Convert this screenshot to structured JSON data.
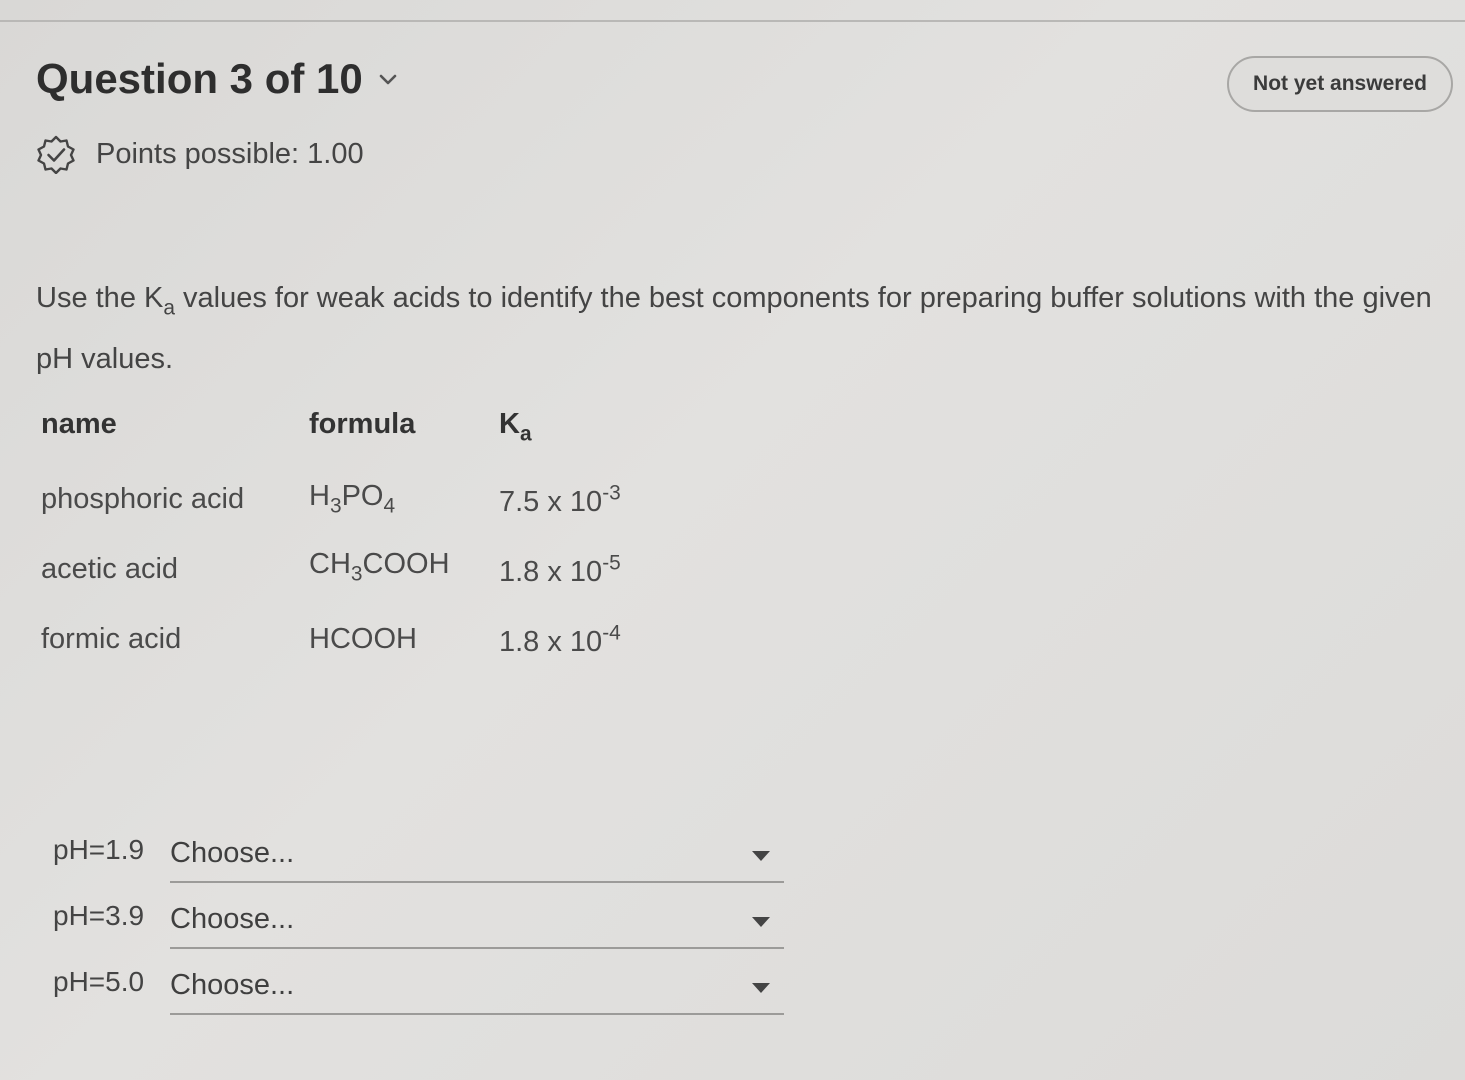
{
  "header": {
    "question_title": "Question 3 of 10",
    "status": "Not yet answered",
    "points_label": "Points possible: 1.00"
  },
  "prompt": {
    "before_ka": "Use the K",
    "ka_sub": "a",
    "after_ka": " values for weak acids to identify the best components for preparing buffer solutions with the given pH values."
  },
  "table": {
    "headers": {
      "name": "name",
      "formula": "formula",
      "ka_main": "K",
      "ka_sub": "a"
    },
    "rows": [
      {
        "name": "phosphoric acid",
        "formula": {
          "p1": "H",
          "s1": "3",
          "p2": "PO",
          "s2": "4"
        },
        "ka": {
          "mantissa": "7.5 x 10",
          "exp": "-3"
        }
      },
      {
        "name": "acetic acid",
        "formula": {
          "p1": "CH",
          "s1": "3",
          "p2": "COOH"
        },
        "ka": {
          "mantissa": "1.8 x 10",
          "exp": "-5"
        }
      },
      {
        "name": "formic acid",
        "formula": {
          "p1": "HCOOH"
        },
        "ka": {
          "mantissa": "1.8 x 10",
          "exp": "-4"
        }
      }
    ]
  },
  "answers": [
    {
      "label": "pH=1.9",
      "value": "Choose..."
    },
    {
      "label": "pH=3.9",
      "value": "Choose..."
    },
    {
      "label": "pH=5.0",
      "value": "Choose..."
    }
  ],
  "icons": {
    "title_chevron": "chevron-down-icon",
    "points_badge": "checkmark-badge-icon",
    "select_caret": "caret-down-icon"
  }
}
